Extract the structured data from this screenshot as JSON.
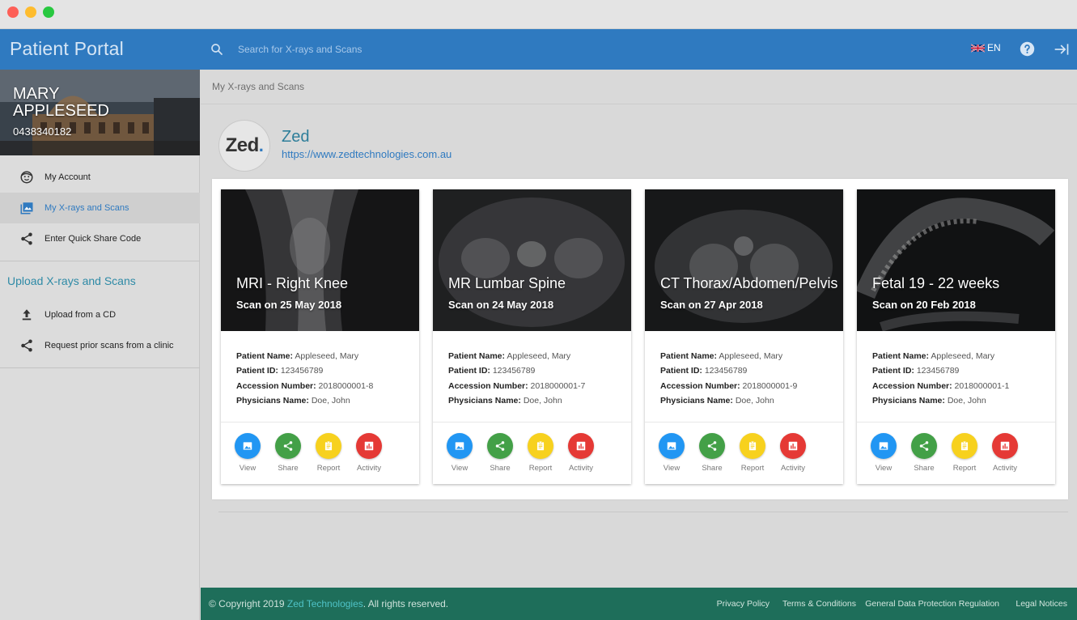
{
  "app": {
    "title": "Patient Portal"
  },
  "search": {
    "placeholder": "Search for X-rays and Scans"
  },
  "header": {
    "language": "EN"
  },
  "profile": {
    "name": "MARY APPLESEED",
    "phone": "0438340182"
  },
  "sidebar": {
    "items": [
      {
        "label": "My Account",
        "icon": "face-icon"
      },
      {
        "label": "My X-rays and Scans",
        "icon": "image-icon",
        "active": true
      },
      {
        "label": "Enter Quick Share Code",
        "icon": "share-icon"
      }
    ],
    "upload_title": "Upload X-rays and Scans",
    "upload_items": [
      {
        "label": "Upload from a CD",
        "icon": "upload-icon"
      },
      {
        "label": "Request prior scans from a clinic",
        "icon": "share-icon"
      }
    ]
  },
  "main": {
    "breadcrumb": "My X-rays and Scans",
    "org": {
      "logo_text": "Zed",
      "name": "Zed",
      "url": "https://www.zedtechnologies.com.au"
    }
  },
  "detail_labels": {
    "patient_name": "Patient Name:",
    "patient_id": "Patient ID:",
    "accession": "Accession Number:",
    "physician": "Physicians Name:"
  },
  "actions": {
    "view": "View",
    "share": "Share",
    "report": "Report",
    "activity": "Activity"
  },
  "cards": [
    {
      "title": "MRI - Right Knee",
      "date": "Scan on 25 May 2018",
      "patient_name": "Appleseed, Mary",
      "patient_id": "123456789",
      "accession": "2018000001-8",
      "physician": "Doe, John"
    },
    {
      "title": "MR Lumbar Spine",
      "date": "Scan on 24 May 2018",
      "patient_name": "Appleseed, Mary",
      "patient_id": "123456789",
      "accession": "2018000001-7",
      "physician": "Doe, John"
    },
    {
      "title": "CT Thorax/Abdomen/Pelvis",
      "date": "Scan on 27 Apr 2018",
      "patient_name": "Appleseed, Mary",
      "patient_id": "123456789",
      "accession": "2018000001-9",
      "physician": "Doe, John"
    },
    {
      "title": "Fetal 19 - 22 weeks",
      "date": "Scan on 20 Feb 2018",
      "patient_name": "Appleseed, Mary",
      "patient_id": "123456789",
      "accession": "2018000001-1",
      "physician": "Doe, John"
    }
  ],
  "footer": {
    "copyright_prefix": "© Copyright 2019 ",
    "company": "Zed Technologies",
    "copyright_suffix": ". All rights reserved.",
    "links": [
      "Privacy Policy",
      "Terms & Conditions",
      "General Data Protection Regulation",
      "Legal Notices"
    ]
  },
  "colors": {
    "primary": "#2f7ac0",
    "footer": "#1e6e5a",
    "view": "#2196f3",
    "share": "#43a047",
    "report": "#f7d11e",
    "activity": "#e53935"
  }
}
